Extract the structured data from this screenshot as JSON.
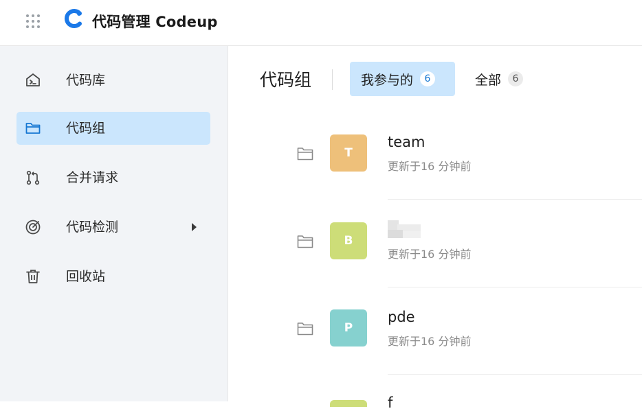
{
  "header": {
    "title": "代码管理 Codeup",
    "logo_color": "#1b79e8"
  },
  "sidebar": {
    "items": [
      {
        "label": "代码库",
        "icon": "repo-icon",
        "active": false
      },
      {
        "label": "代码组",
        "icon": "folder-icon",
        "active": true
      },
      {
        "label": "合并请求",
        "icon": "merge-request-icon",
        "active": false
      },
      {
        "label": "代码检测",
        "icon": "scan-target-icon",
        "active": false,
        "has_submenu": true
      },
      {
        "label": "回收站",
        "icon": "trash-icon",
        "active": false
      }
    ]
  },
  "main": {
    "title": "代码组",
    "tabs": [
      {
        "label": "我参与的",
        "count": "6",
        "active": true
      },
      {
        "label": "全部",
        "count": "6",
        "active": false
      }
    ],
    "groups": [
      {
        "avatar_letter": "T",
        "avatar_color": "#eec07a",
        "name": "team",
        "updated": "更新于16 分钟前"
      },
      {
        "avatar_letter": "B",
        "avatar_color": "#cddd78",
        "name": "",
        "name_obscured": true,
        "updated": "更新于16 分钟前"
      },
      {
        "avatar_letter": "P",
        "avatar_color": "#86d1cf",
        "name": "pde",
        "updated": "更新于16 分钟前"
      }
    ],
    "partial_row": {
      "avatar_color": "#cddd78",
      "name_fragment": "f"
    }
  },
  "colors": {
    "accent": "#cbe6fd",
    "sidebar_bg": "#f2f4f7",
    "count_active": "#1677d2"
  }
}
